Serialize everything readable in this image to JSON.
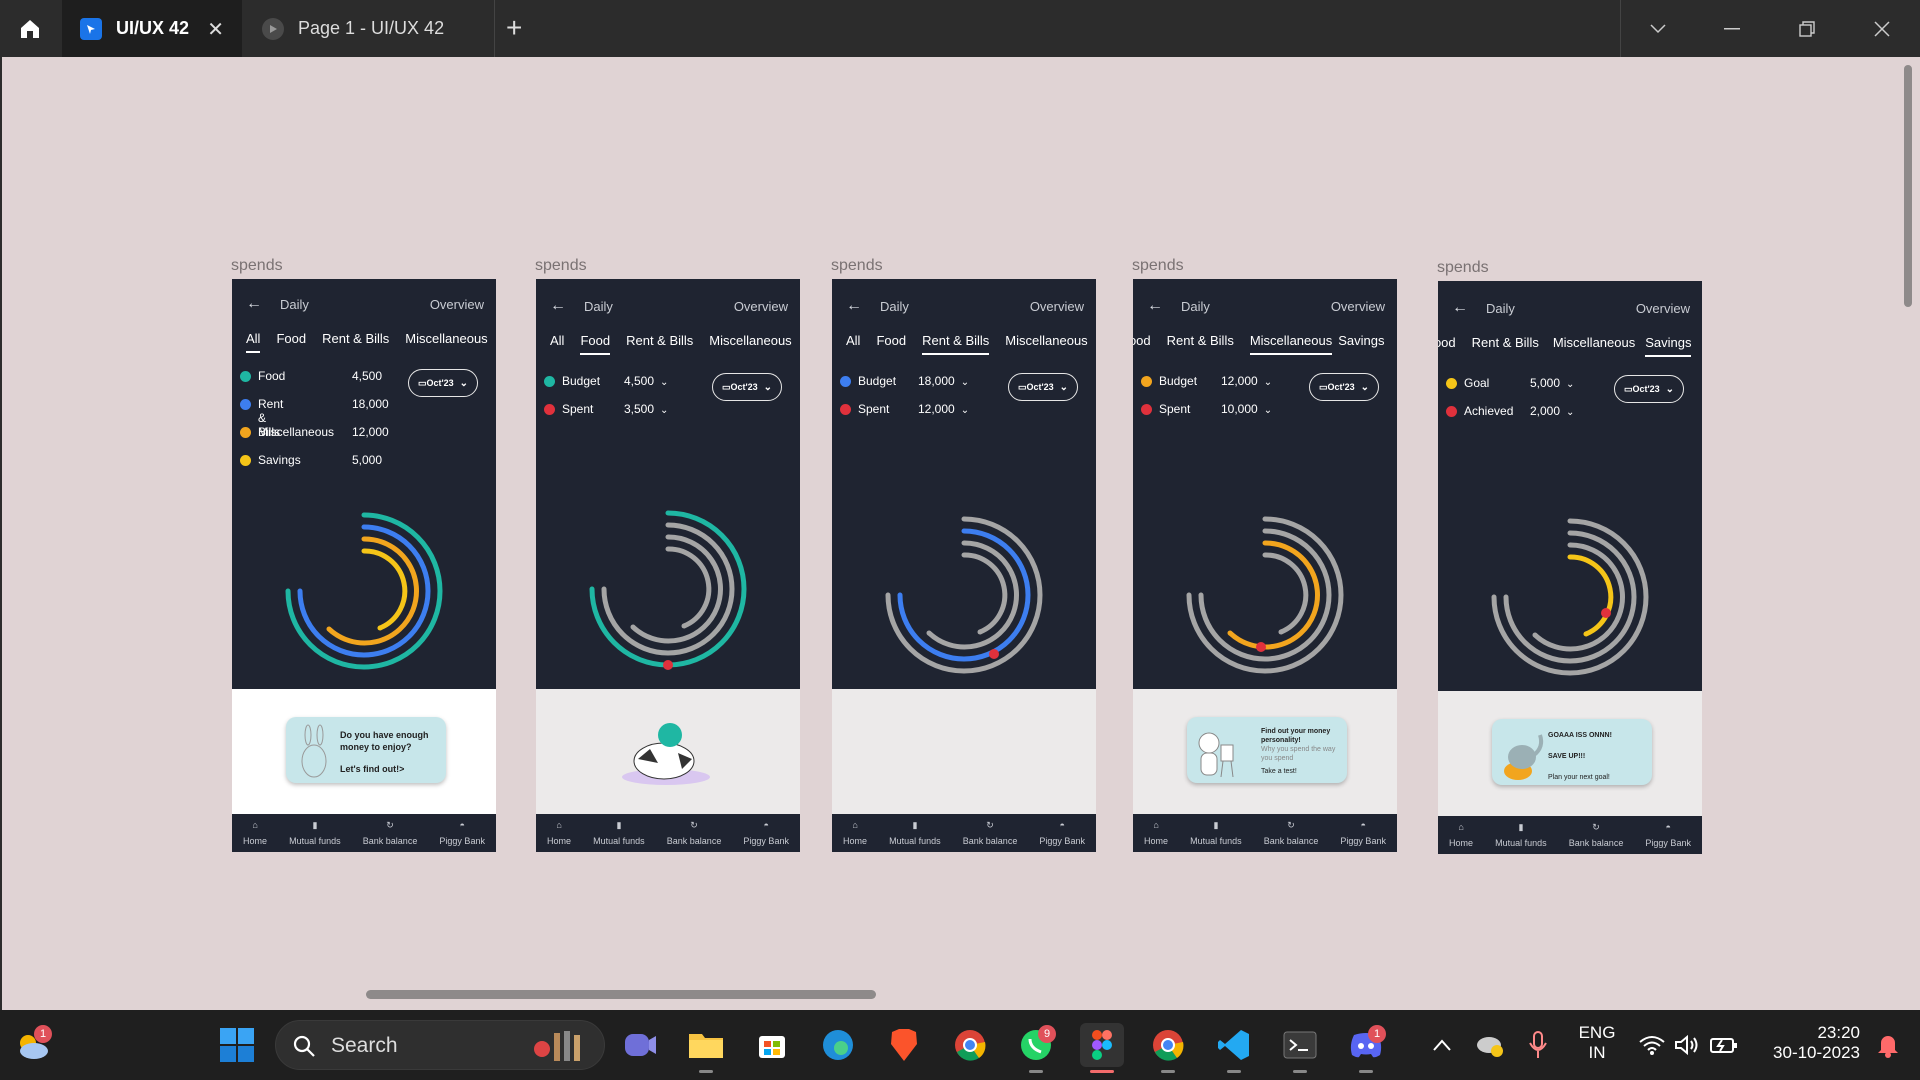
{
  "titlebar": {
    "tabs": [
      {
        "label": "UI/UX 42",
        "active": true
      },
      {
        "label": "Page 1 - UI/UX 42",
        "active": false
      }
    ]
  },
  "frames": [
    {
      "label": "spends",
      "header": {
        "daily": "Daily",
        "overview": "Overview"
      },
      "tabs": [
        "All",
        "Food",
        "Rent & Bills",
        "Miscellaneous"
      ],
      "active_tab": "All",
      "legend": [
        {
          "name": "Food",
          "value": "4,500",
          "color": "#1fb7a3"
        },
        {
          "name": "Rent & Bills",
          "value": "18,000",
          "color": "#3d7ef0"
        },
        {
          "name": "Miscellaneous",
          "value": "12,000",
          "color": "#f2a51e"
        },
        {
          "name": "Savings",
          "value": "5,000",
          "color": "#f5c518"
        }
      ],
      "date": "Oct'23",
      "card": {
        "line1": "Do you have enough",
        "line2": "money to enjoy?",
        "line3": "Let's find out!>"
      }
    },
    {
      "label": "spends",
      "header": {
        "daily": "Daily",
        "overview": "Overview"
      },
      "tabs": [
        "All",
        "Food",
        "Rent & Bills",
        "Miscellaneous"
      ],
      "active_tab": "Food",
      "legend": [
        {
          "name": "Budget",
          "value": "4,500",
          "color": "#1fb7a3"
        },
        {
          "name": "Spent",
          "value": "3,500",
          "color": "#e0313c"
        }
      ],
      "date": "Oct'23"
    },
    {
      "label": "spends",
      "header": {
        "daily": "Daily",
        "overview": "Overview"
      },
      "tabs": [
        "All",
        "Food",
        "Rent & Bills",
        "Miscellaneous"
      ],
      "active_tab": "Rent & Bills",
      "legend": [
        {
          "name": "Budget",
          "value": "18,000",
          "color": "#3d7ef0"
        },
        {
          "name": "Spent",
          "value": "12,000",
          "color": "#e0313c"
        }
      ],
      "date": "Oct'23"
    },
    {
      "label": "spends",
      "header": {
        "daily": "Daily",
        "overview": "Overview"
      },
      "tabs": [
        "Food",
        "Rent & Bills",
        "Miscellaneous",
        "Savings"
      ],
      "active_tab": "Miscellaneous",
      "legend": [
        {
          "name": "Budget",
          "value": "12,000",
          "color": "#f2a51e"
        },
        {
          "name": "Spent",
          "value": "10,000",
          "color": "#e0313c"
        }
      ],
      "date": "Oct'23",
      "card": {
        "line1": "Find out your money",
        "line2": "personality!",
        "line3": "Why you spend the way you spend",
        "line4": "Take a test!"
      }
    },
    {
      "label": "spends",
      "header": {
        "daily": "Daily",
        "overview": "Overview"
      },
      "tabs": [
        "Food",
        "Rent & Bills",
        "Miscellaneous",
        "Savings"
      ],
      "active_tab": "Savings",
      "legend": [
        {
          "name": "Goal",
          "value": "5,000",
          "color": "#f5c518"
        },
        {
          "name": "Achieved",
          "value": "2,000",
          "color": "#e0313c"
        }
      ],
      "date": "Oct'23",
      "card": {
        "line1": "GOAAA ISS ONNN!",
        "line2": "SAVE UP!!!",
        "line3": "Plan your next goal!"
      }
    }
  ],
  "nav": [
    "Home",
    "Mutual funds",
    "Bank balance",
    "Piggy Bank"
  ],
  "taskbar": {
    "search": "Search",
    "weather_badge": "1",
    "whatsapp_badge": "9",
    "discord_badge": "1",
    "lang1": "ENG",
    "lang2": "IN",
    "time": "23:20",
    "date": "30-10-2023"
  }
}
